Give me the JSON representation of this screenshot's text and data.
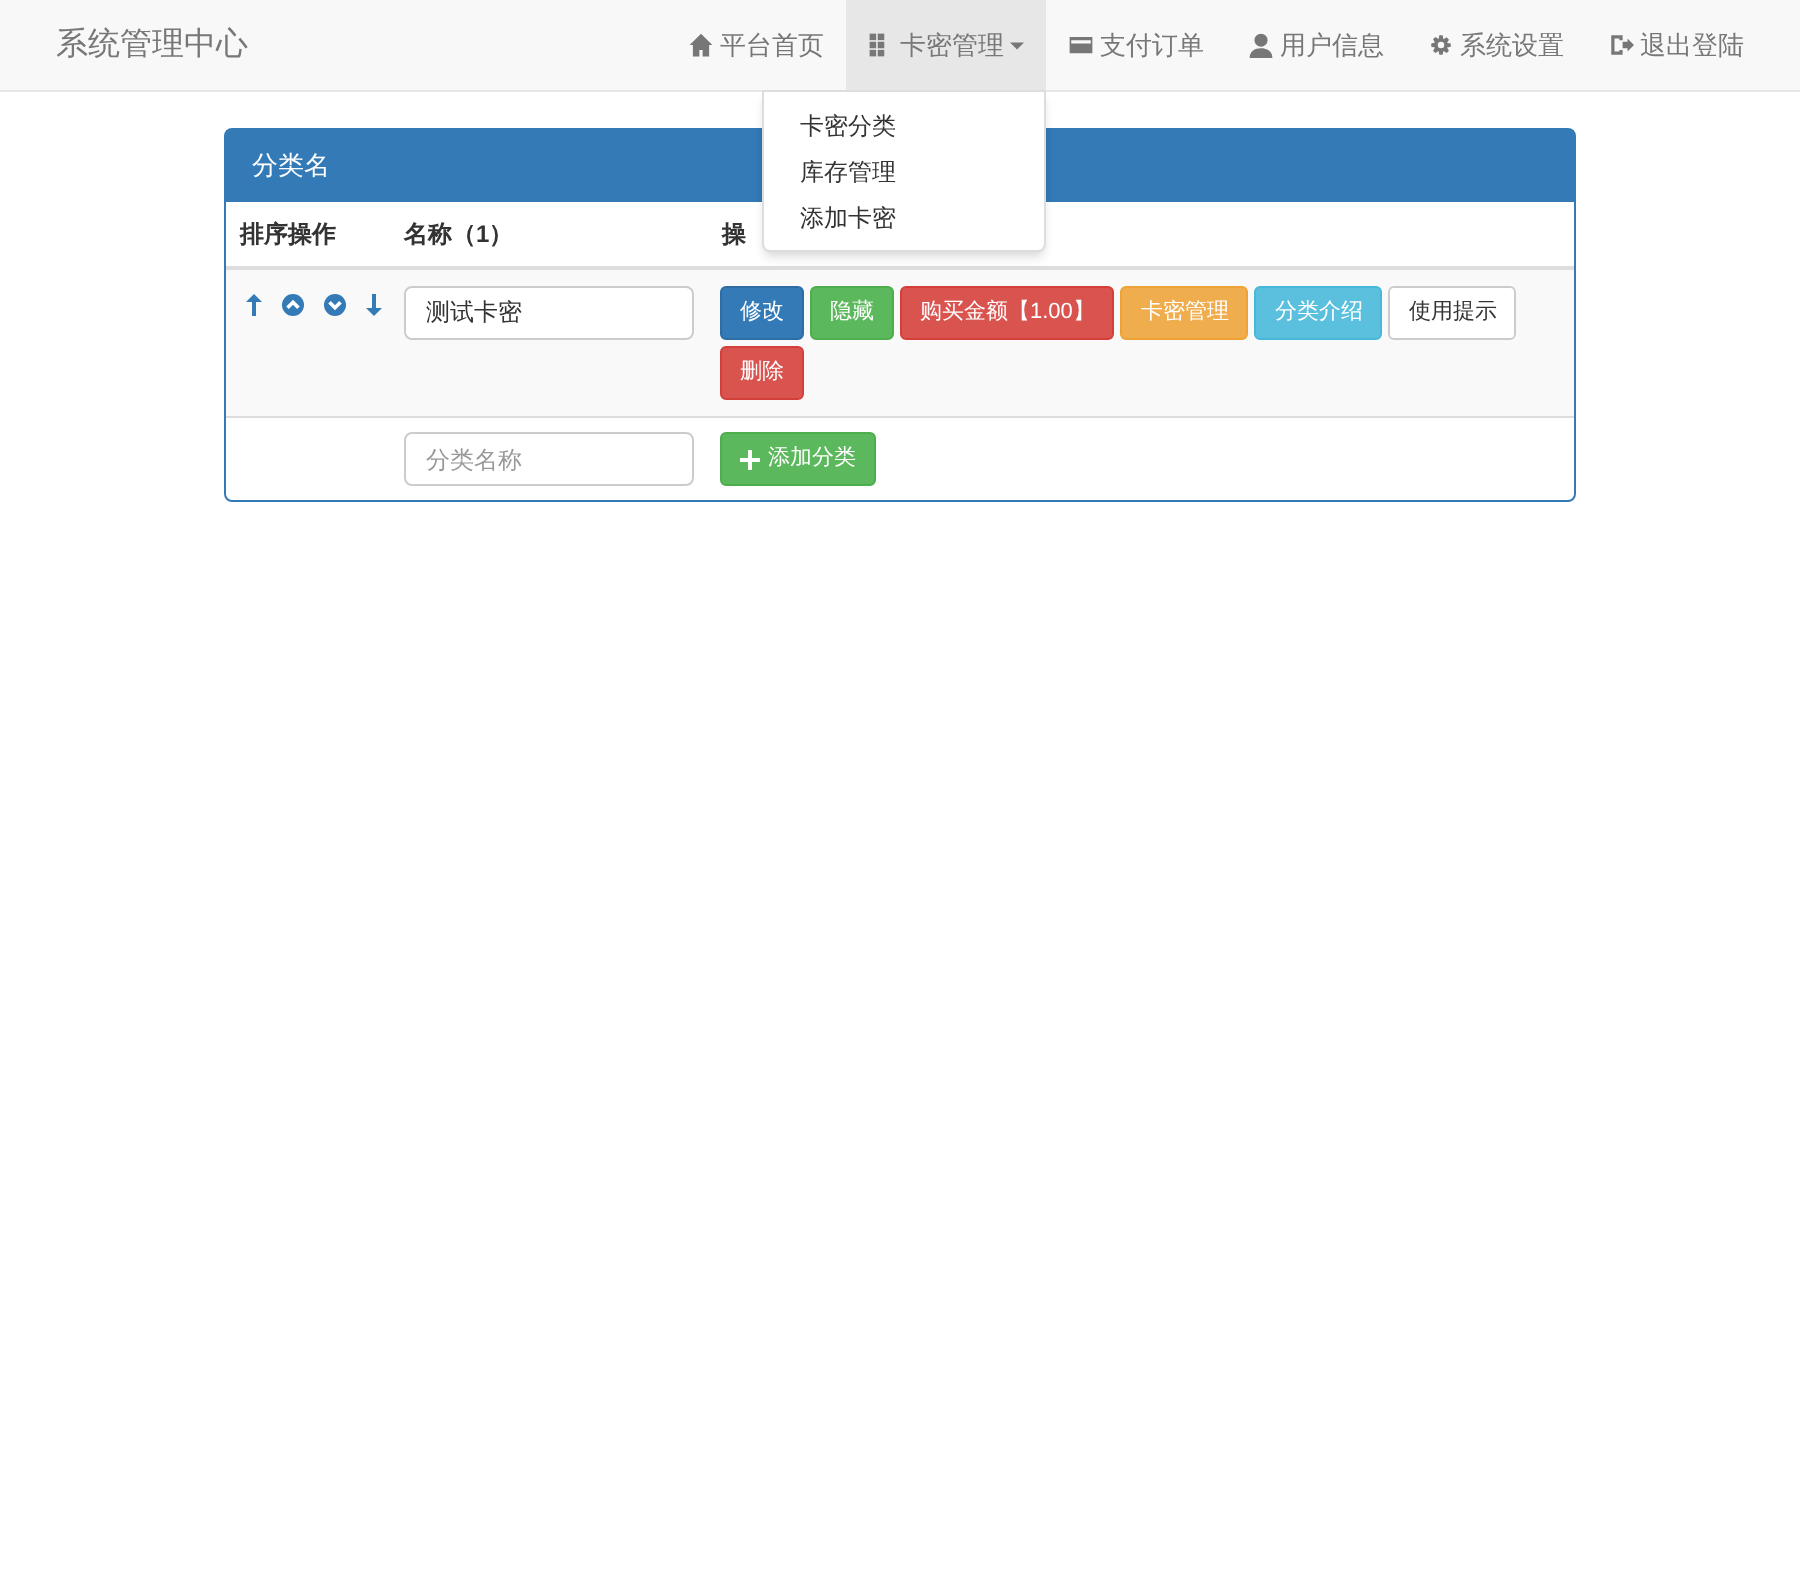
{
  "brand": "系统管理中心",
  "nav": [
    {
      "label": "平台首页",
      "kind": "home",
      "selected": false,
      "dropdown": false
    },
    {
      "label": "卡密管理",
      "kind": "grid",
      "selected": true,
      "dropdown": true
    },
    {
      "label": "支付订单",
      "kind": "card",
      "selected": false,
      "dropdown": false
    },
    {
      "label": "用户信息",
      "kind": "user",
      "selected": false,
      "dropdown": false
    },
    {
      "label": "系统设置",
      "kind": "gear",
      "selected": false,
      "dropdown": false
    },
    {
      "label": "退出登陆",
      "kind": "logout",
      "selected": false,
      "dropdown": false
    }
  ],
  "dropdown_menu": [
    "卡密分类",
    "库存管理",
    "添加卡密"
  ],
  "panel": {
    "title": "分类名",
    "columns": [
      "排序操作",
      "名称（1）",
      "操"
    ],
    "rows": [
      {
        "name": "测试卡密",
        "buttons": [
          {
            "label": "修改",
            "kind": "primary"
          },
          {
            "label": "隐藏",
            "kind": "success"
          },
          {
            "label": "购买金额【1.00】",
            "kind": "danger"
          },
          {
            "label": "卡密管理",
            "kind": "warning"
          },
          {
            "label": "分类介绍",
            "kind": "info"
          },
          {
            "label": "使用提示",
            "kind": "default"
          },
          {
            "label": "删除",
            "kind": "danger"
          }
        ]
      }
    ],
    "new_row": {
      "placeholder": "分类名称",
      "button": "添加分类"
    }
  }
}
